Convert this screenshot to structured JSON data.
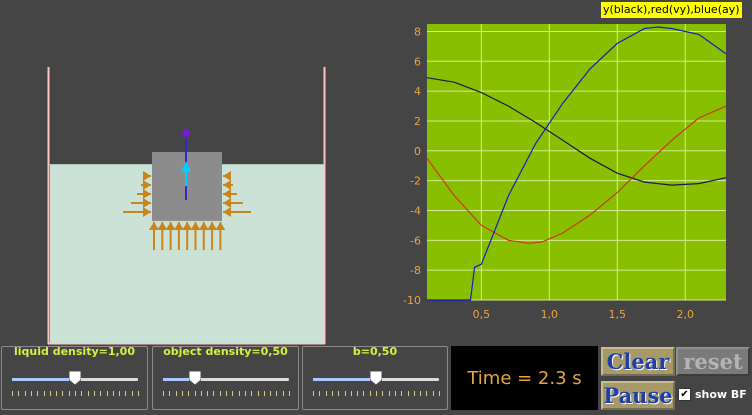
{
  "chart": {
    "title": "y(black),red(vy),blue(ay)"
  },
  "chart_data": {
    "type": "line",
    "xlim": [
      0.1,
      2.3
    ],
    "ylim": [
      -10,
      8.5
    ],
    "x_ticks": [
      "0,5",
      "1,0",
      "1,5",
      "2,0"
    ],
    "x_tick_values": [
      0.5,
      1.0,
      1.5,
      2.0
    ],
    "y_ticks": [
      "8",
      "6",
      "4",
      "2",
      "0",
      "-2",
      "-4",
      "-6",
      "-8",
      "-10"
    ],
    "y_tick_values": [
      8,
      6,
      4,
      2,
      0,
      -2,
      -4,
      -6,
      -8,
      -10
    ],
    "grid": true,
    "series": [
      {
        "name": "y",
        "color": "#1a1a4a",
        "x": [
          0.1,
          0.3,
          0.5,
          0.7,
          0.9,
          1.1,
          1.3,
          1.5,
          1.7,
          1.9,
          2.1,
          2.3
        ],
        "y": [
          4.9,
          4.6,
          3.9,
          3.0,
          1.9,
          0.7,
          -0.5,
          -1.5,
          -2.1,
          -2.3,
          -2.2,
          -1.8
        ]
      },
      {
        "name": "vy",
        "color": "#c83a1a",
        "x": [
          0.1,
          0.3,
          0.5,
          0.7,
          0.85,
          0.95,
          1.1,
          1.3,
          1.5,
          1.7,
          1.9,
          2.1,
          2.3
        ],
        "y": [
          -0.5,
          -3.0,
          -5.0,
          -6.0,
          -6.2,
          -6.1,
          -5.5,
          -4.3,
          -2.8,
          -1.0,
          0.7,
          2.2,
          3.0
        ]
      },
      {
        "name": "ay",
        "color": "#1a1ac8",
        "x": [
          0.1,
          0.3,
          0.42,
          0.45,
          0.5,
          0.7,
          0.9,
          1.1,
          1.3,
          1.5,
          1.7,
          1.8,
          1.9,
          2.1,
          2.3
        ],
        "y": [
          -10,
          -10,
          -10,
          -7.8,
          -7.6,
          -3.0,
          0.5,
          3.2,
          5.5,
          7.2,
          8.2,
          8.3,
          8.2,
          7.8,
          6.5
        ]
      }
    ]
  },
  "controls": {
    "liquid_density_label": "liquid density=1,00",
    "liquid_density_value": 0.5,
    "object_density_label": "object density=0,50",
    "object_density_value": 0.25,
    "b_label": "b=0,50",
    "b_value": 0.5
  },
  "time_display": "Time = 2.3 s",
  "buttons": {
    "clear": "Clear",
    "reset": "reset",
    "pause": "Pause"
  },
  "show_bf": {
    "label": "show BF",
    "checked": true
  },
  "colors": {
    "background": "#454545",
    "liquid": "#cde2d6",
    "container": "#ffc4c4",
    "block": "#8c8c8c",
    "force_arrow": "#c8851e",
    "plot_bg": "#88c000",
    "axis_label": "#e8a43e"
  }
}
